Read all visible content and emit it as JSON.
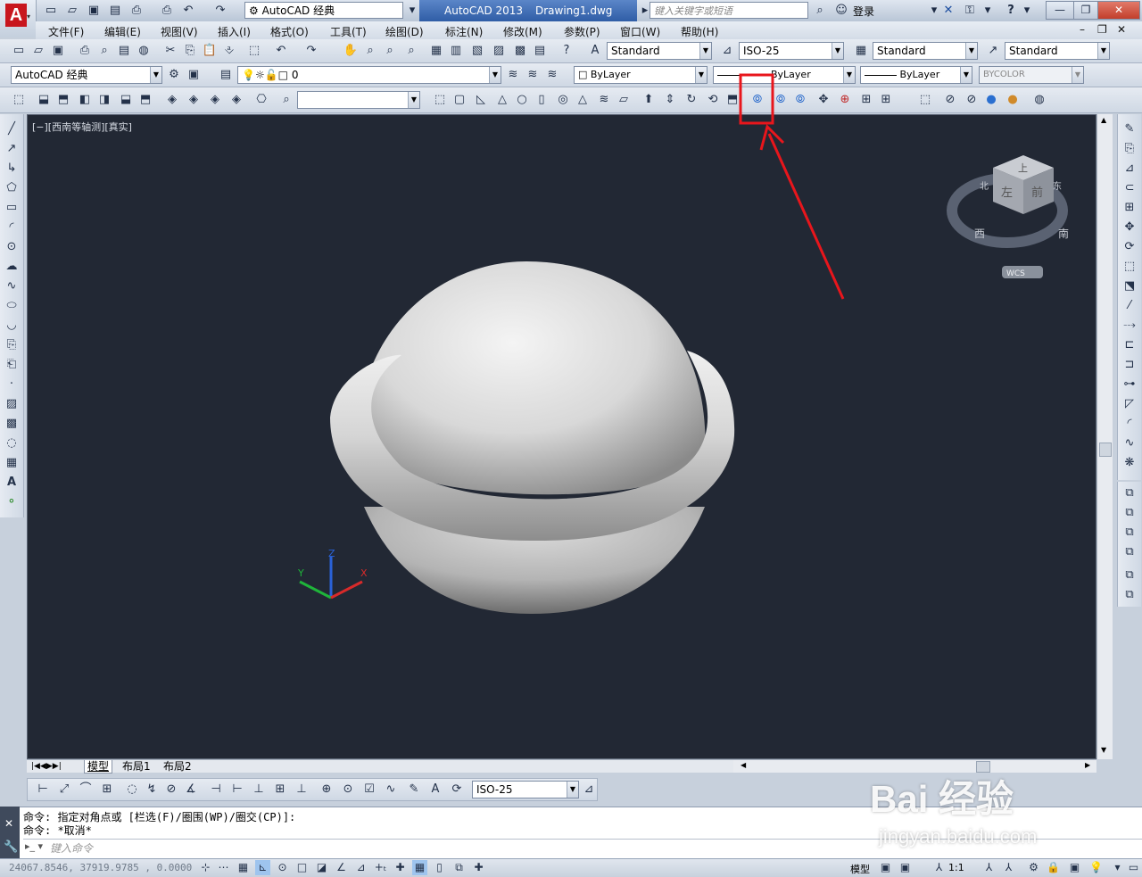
{
  "title_bar": {
    "workspace_combo": "AutoCAD 经典",
    "app_name": "AutoCAD 2013",
    "document": "Drawing1.dwg",
    "search_placeholder": "键入关键字或短语",
    "login_label": "登录",
    "help_label": "?"
  },
  "menu": [
    "文件(F)",
    "编辑(E)",
    "视图(V)",
    "插入(I)",
    "格式(O)",
    "工具(T)",
    "绘图(D)",
    "标注(N)",
    "修改(M)",
    "参数(P)",
    "窗口(W)",
    "帮助(H)"
  ],
  "styles_toolbar": {
    "text_style": "Standard",
    "dim_style": "ISO-25",
    "table_style": "Standard",
    "mleader_style": "Standard"
  },
  "layers_toolbar": {
    "workspace": "AutoCAD 经典",
    "current_layer": "0",
    "color": "ByLayer",
    "linetype": "ByLayer",
    "lineweight": "ByLayer",
    "plot_style": "BYCOLOR"
  },
  "viewport": {
    "label": "[−][西南等轴测][真实]",
    "viewcube": {
      "top": "上",
      "left": "左",
      "front": "前",
      "north": "北",
      "south": "南",
      "west": "西",
      "east": "东"
    },
    "wcs_label": "WCS",
    "ucs": {
      "x": "X",
      "y": "Y",
      "z": "Z"
    }
  },
  "tabs": [
    "模型",
    "布局1",
    "布局2"
  ],
  "dim_toolbar": {
    "dim_style": "ISO-25"
  },
  "command": {
    "line1": "命令: 指定对角点或 [栏选(F)/圈围(WP)/圈交(CP)]:",
    "line2": "命令: *取消*",
    "input_placeholder": "键入命令"
  },
  "status": {
    "coordinates": "24067.8546, 37919.9785 , 0.0000",
    "model_label": "模型",
    "scale": "1:1"
  },
  "watermark": {
    "brand": "Bai 经验",
    "url": "jingyan.baidu.com"
  },
  "highlight_color": "#e8161c",
  "viewport_bg": "#222834"
}
